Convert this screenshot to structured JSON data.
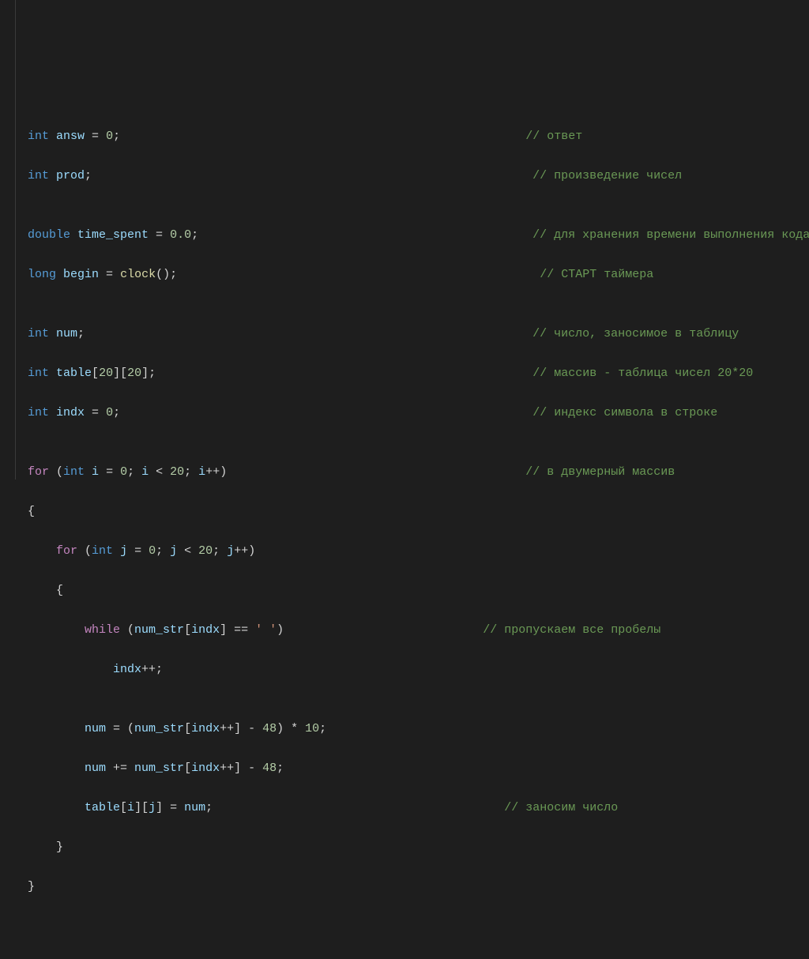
{
  "code": {
    "l1": {
      "kw_int": "int",
      "var": "answ",
      "eq": " = ",
      "val": "0",
      "semi": ";",
      "pad": "                                                         ",
      "cmt": "// ответ"
    },
    "l2": {
      "kw_int": "int",
      "var": "prod",
      "semi": ";",
      "pad": "                                                              ",
      "cmt": "// произведение чисел"
    },
    "l3": {
      "blank": ""
    },
    "l4": {
      "kw_double": "double",
      "var": "time_spent",
      "eq": " = ",
      "val": "0.0",
      "semi": ";",
      "pad": "                                               ",
      "cmt": "// для хранения времени выполнения кода"
    },
    "l5": {
      "kw_long": "long",
      "var": "begin",
      "eq": " = ",
      "fn": "clock",
      "args": "()",
      "semi": ";",
      "pad": "                                                   ",
      "cmt": "// СТАРТ таймера"
    },
    "l6": {
      "blank": ""
    },
    "l7": {
      "kw_int": "int",
      "var": "num",
      "semi": ";",
      "pad": "                                                               ",
      "cmt": "// число, заносимое в таблицу"
    },
    "l8": {
      "kw_int": "int",
      "var": "table",
      "br1": "[",
      "v1": "20",
      "br2": "][",
      "v2": "20",
      "br3": "]",
      "semi": ";",
      "pad": "                                                     ",
      "cmt": "// массив - таблица чисел 20*20"
    },
    "l9": {
      "kw_int": "int",
      "var": "indx",
      "eq": " = ",
      "val": "0",
      "semi": ";",
      "pad": "                                                          ",
      "cmt": "// индекс символа в строке"
    },
    "l10": {
      "blank": ""
    },
    "l11": {
      "kw_for": "for",
      "op": " (",
      "kw_int": "int",
      "var_i": " i",
      "eq": " = ",
      "v0": "0",
      "semi1": "; ",
      "var_i2": "i",
      "lt": " < ",
      "v20": "20",
      "semi2": "; ",
      "var_i3": "i",
      "inc": "++)",
      "pad": "                                          ",
      "cmt": "// в двумерный массив"
    },
    "l12": {
      "brace": "{"
    },
    "l13": {
      "indent": "    ",
      "kw_for": "for",
      "op": " (",
      "kw_int": "int",
      "var_j": " j",
      "eq": " = ",
      "v0": "0",
      "semi1": "; ",
      "var_j2": "j",
      "lt": " < ",
      "v20": "20",
      "semi2": "; ",
      "var_j3": "j",
      "inc": "++)"
    },
    "l14": {
      "indent": "    ",
      "brace": "{"
    },
    "l15": {
      "indent": "        ",
      "kw_while": "while",
      "op": " (",
      "var_ns": "num_str",
      "br1": "[",
      "var_idx": "indx",
      "br2": "] == ",
      "str": "' '",
      "cp": ")",
      "pad": "                            ",
      "cmt": "// пропускаем все пробелы"
    },
    "l16": {
      "indent": "            ",
      "var_idx": "indx",
      "inc": "++;"
    },
    "l17": {
      "blank": ""
    },
    "l18": {
      "indent": "        ",
      "var_num": "num",
      "eq": " = (",
      "var_ns": "num_str",
      "br1": "[",
      "var_idx": "indx",
      "inc": "++",
      "br2": "] - ",
      "v48": "48",
      "cp": ") * ",
      "v10": "10",
      "semi": ";"
    },
    "l19": {
      "indent": "        ",
      "var_num": "num",
      "peq": " += ",
      "var_ns": "num_str",
      "br1": "[",
      "var_idx": "indx",
      "inc": "++",
      "br2": "] - ",
      "v48": "48",
      "semi": ";"
    },
    "l20": {
      "indent": "        ",
      "var_tbl": "table",
      "br1": "[",
      "var_i": "i",
      "br2": "][",
      "var_j": "j",
      "br3": "] = ",
      "var_num": "num",
      "semi": ";",
      "pad": "                                         ",
      "cmt": "// заносим число"
    },
    "l21": {
      "indent": "    ",
      "brace": "}"
    },
    "l22": {
      "brace": "}"
    }
  }
}
